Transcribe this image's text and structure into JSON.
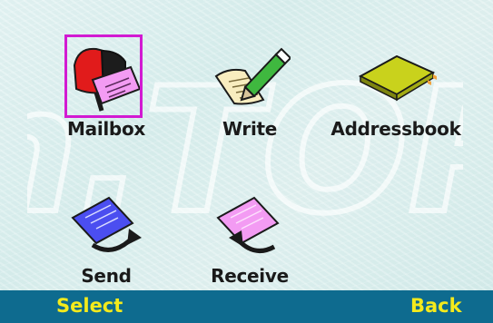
{
  "watermark": {
    "text": "n.TOP"
  },
  "menu": {
    "items": [
      {
        "label": "Mailbox",
        "icon": "mailbox-icon",
        "selected": true
      },
      {
        "label": "Write",
        "icon": "write-icon",
        "selected": false
      },
      {
        "label": "Addressbook",
        "icon": "addressbook-icon",
        "selected": false
      },
      {
        "label": "Send",
        "icon": "send-icon",
        "selected": false
      },
      {
        "label": "Receive",
        "icon": "receive-icon",
        "selected": false
      }
    ]
  },
  "softkeys": {
    "left": "Select",
    "right": "Back"
  },
  "colors": {
    "selection": "#d21ad2",
    "softbar": "#0e6b8f",
    "softkey_text": "#f4ea1c"
  }
}
